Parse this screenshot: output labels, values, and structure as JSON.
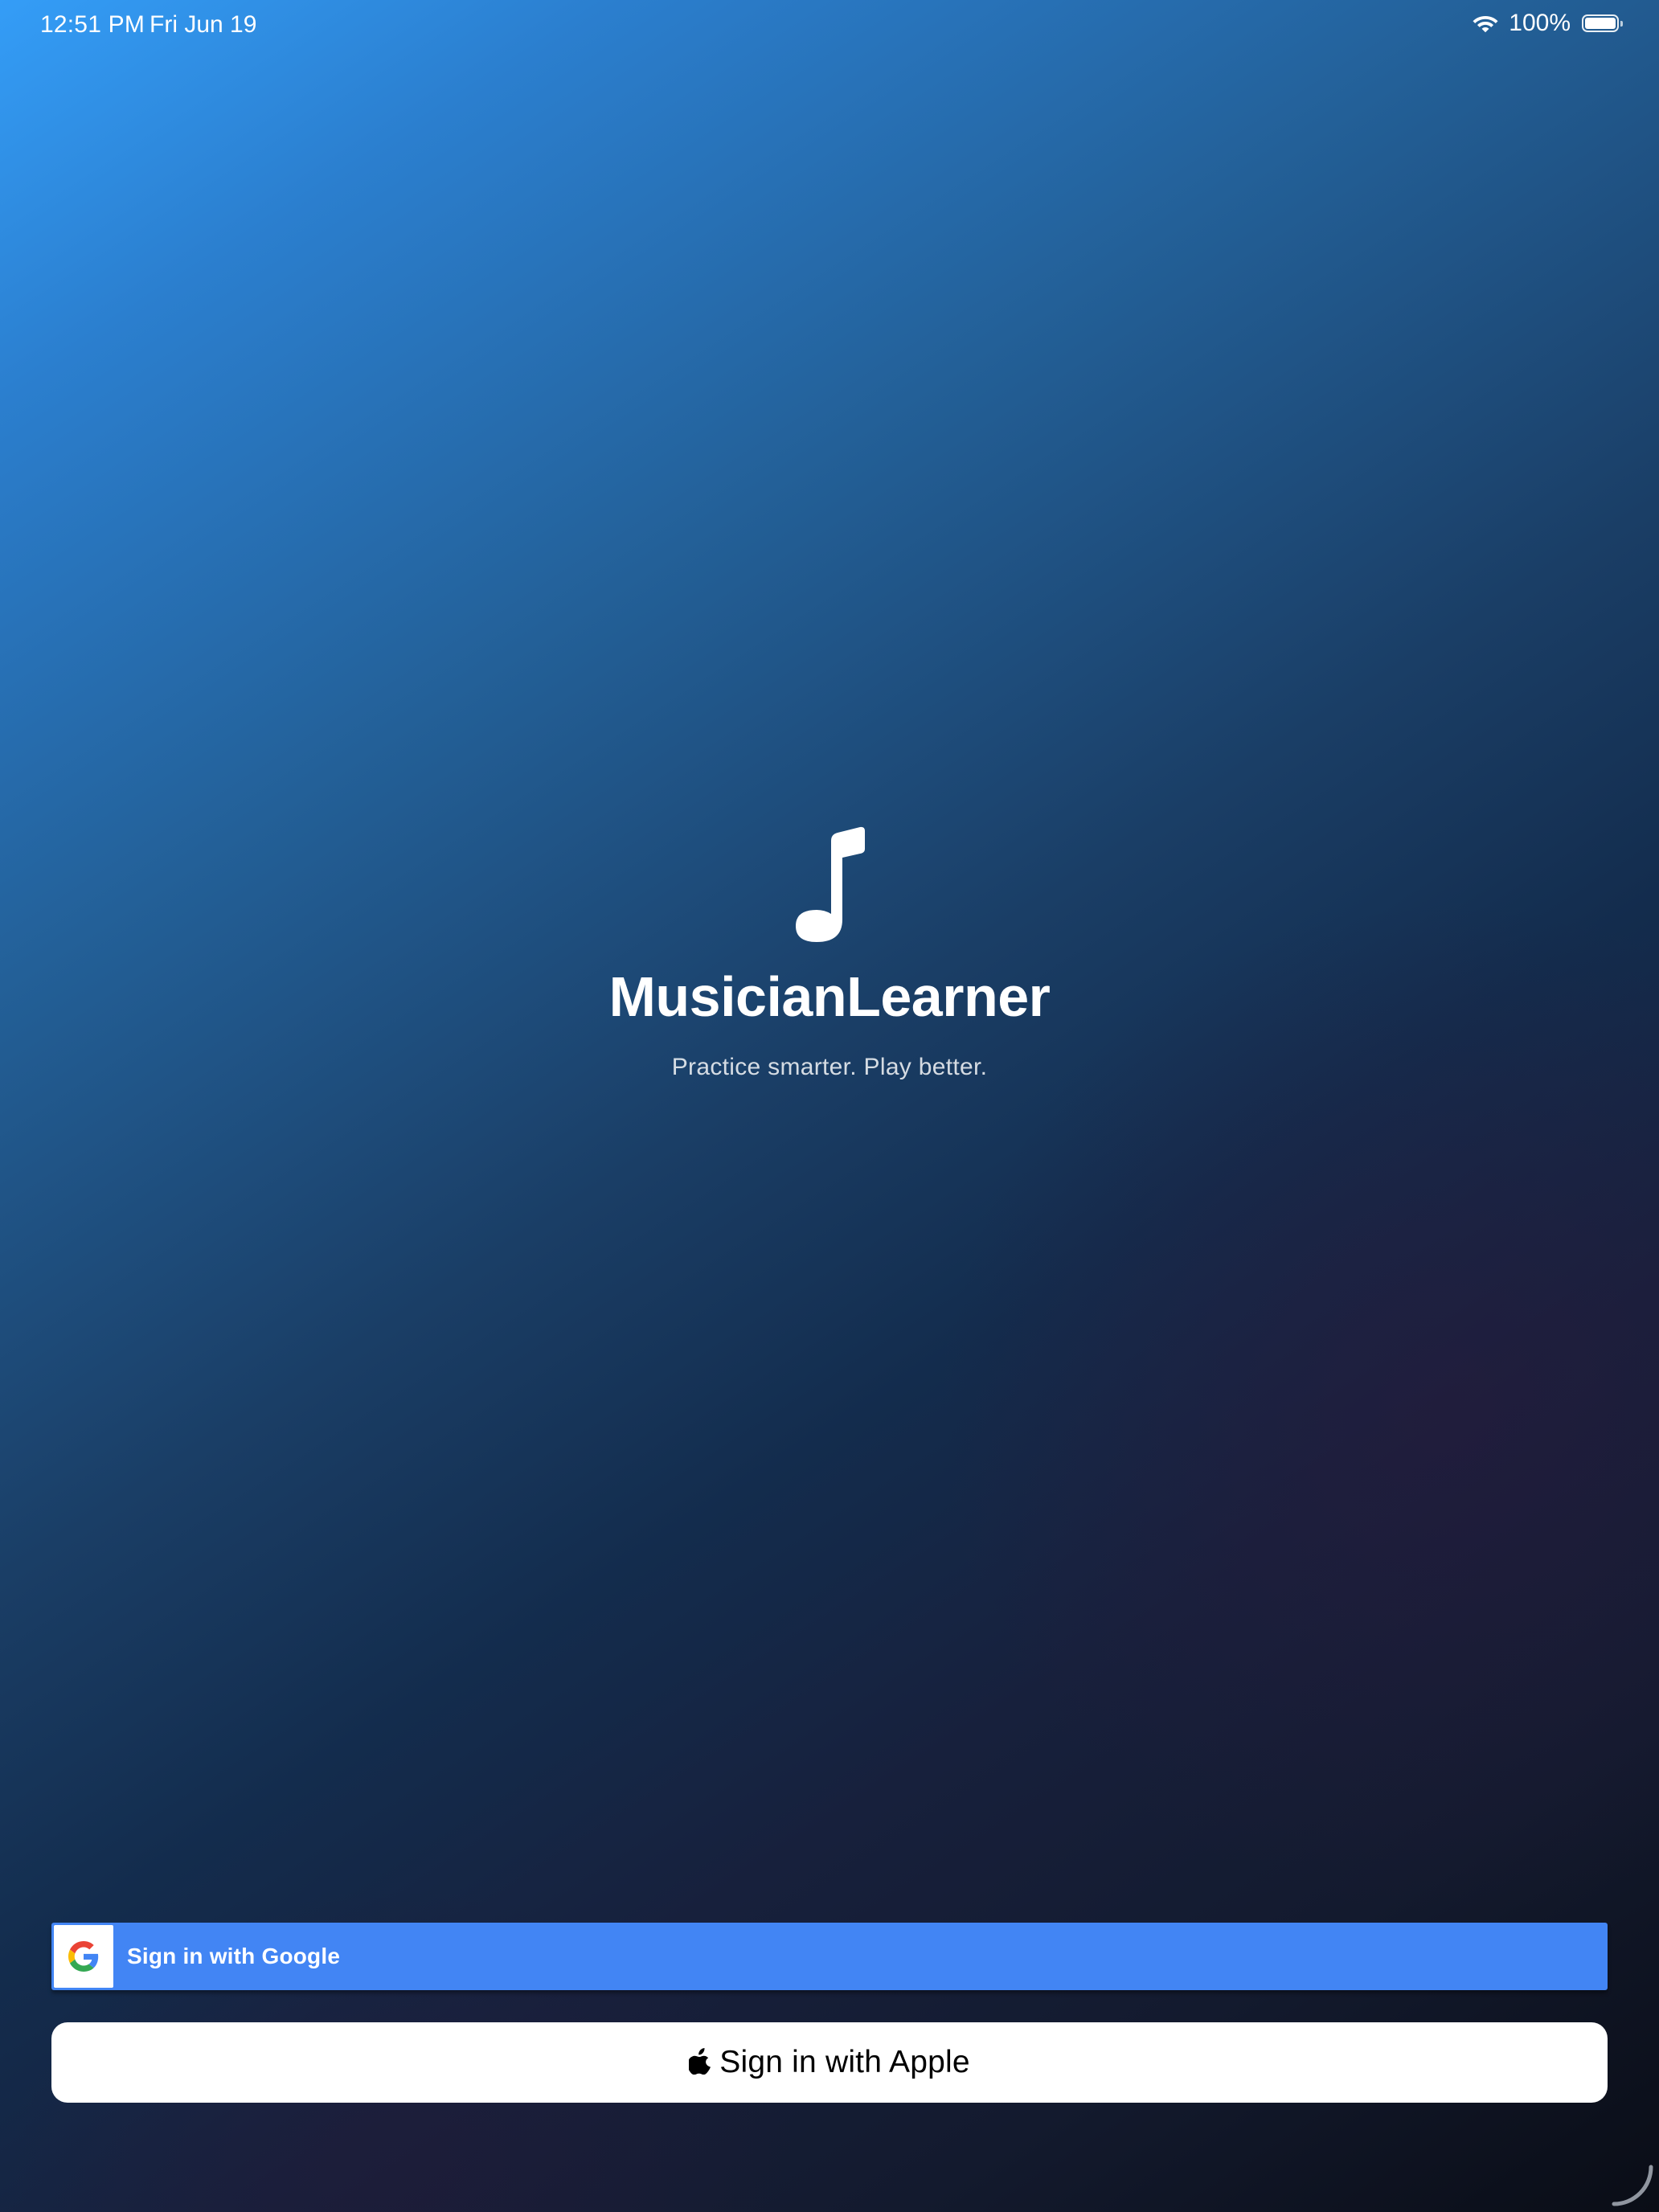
{
  "status_bar": {
    "time": "12:51 PM",
    "date": "Fri Jun 19",
    "battery": "100%",
    "icons": [
      "wifi-icon",
      "battery-icon"
    ]
  },
  "hero": {
    "icon": "music-note-icon",
    "title": "MusicianLearner",
    "tagline": "Practice smarter. Play better."
  },
  "auth": {
    "google_label": "Sign in with Google",
    "google_icon": "google-g-icon",
    "apple_label": "Sign in with Apple",
    "apple_icon": "apple-logo-icon"
  },
  "colors": {
    "google_blue": "#4285f4",
    "gradient_top": "#349df7",
    "gradient_bottom": "#0a0d16",
    "apple_button_bg": "#ffffff"
  }
}
